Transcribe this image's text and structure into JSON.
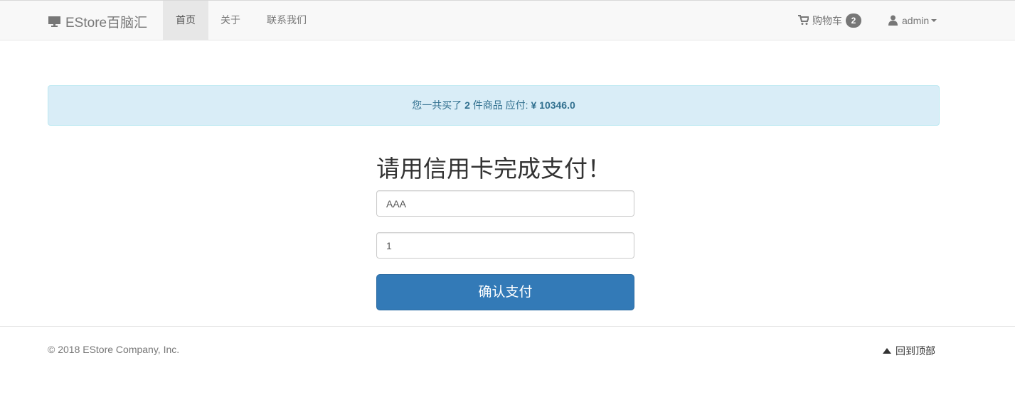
{
  "navbar": {
    "brand": "EStore百脑汇",
    "brand_icon": "monitor-icon",
    "items": [
      {
        "label": "首页",
        "active": true
      },
      {
        "label": "关于",
        "active": false
      },
      {
        "label": "联系我们",
        "active": false
      }
    ],
    "cart": {
      "icon": "shopping-cart-icon",
      "label": "购物车",
      "count": "2"
    },
    "user": {
      "icon": "user-icon",
      "label": "admin"
    }
  },
  "alert": {
    "prefix": "您一共买了",
    "quantity": "2",
    "middle": "件商品 应付:",
    "currency": "¥",
    "amount": "10346.0"
  },
  "payment": {
    "title": "请用信用卡完成支付！",
    "name_value": "AAA",
    "card_value": "1",
    "submit_label": "确认支付"
  },
  "footer": {
    "copyright": "© 2018 EStore Company, Inc.",
    "back_to_top": "回到顶部",
    "back_to_top_icon": "triangle-up-icon"
  },
  "colors": {
    "navbar_bg": "#f8f8f8",
    "alert_bg": "#d9edf7",
    "alert_text": "#31708f",
    "primary": "#337ab7"
  }
}
